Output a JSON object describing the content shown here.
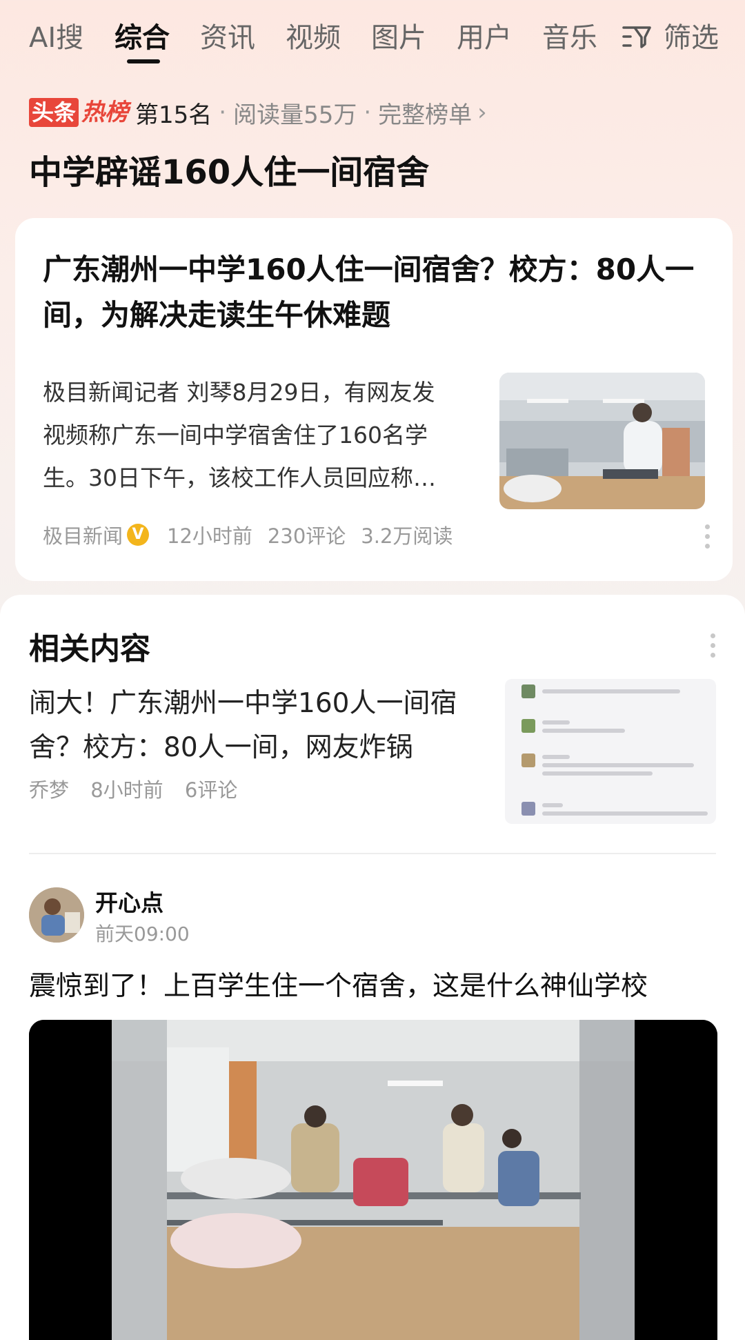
{
  "tabs": [
    "AI搜",
    "综合",
    "资讯",
    "视频",
    "图片",
    "用户",
    "音乐"
  ],
  "active_tab": "综合",
  "filter_label": "筛选",
  "hot": {
    "logo_box": "头条",
    "logo_text": "热榜",
    "rank": "第15名",
    "separator": "·",
    "reads": "阅读量55万",
    "full_list": "完整榜单",
    "chevron": "›",
    "title": "中学辟谣160人住一间宿舍"
  },
  "article": {
    "title": "广东潮州一中学160人住一间宿舍？校方：80人一间，为解决走读生午休难题",
    "summary": "极目新闻记者 刘琴8月29日，有网友发视频称广东一间中学宿舍住了160名学生。30日下午，该校工作人员回应称…",
    "source": "极目新闻",
    "verified_badge": "V",
    "time": "12小时前",
    "comments": "230评论",
    "reads": "3.2万阅读"
  },
  "related": {
    "section_title": "相关内容",
    "item": {
      "title": "闹大！广东潮州一中学160人一间宿舍？校方：80人一间，网友炸锅",
      "author": "乔梦",
      "time": "8小时前",
      "comments": "6评论"
    }
  },
  "post": {
    "user": "开心点",
    "time": "前天09:00",
    "text": "震惊到了！上百学生住一个宿舍，这是什么神仙学校"
  },
  "colors": {
    "accent_red": "#e8463a",
    "badge_gold": "#f3b51c",
    "muted": "#999999"
  },
  "icons": [
    "filter-icon",
    "chevron-right-icon",
    "verified-badge-icon",
    "more-icon"
  ]
}
